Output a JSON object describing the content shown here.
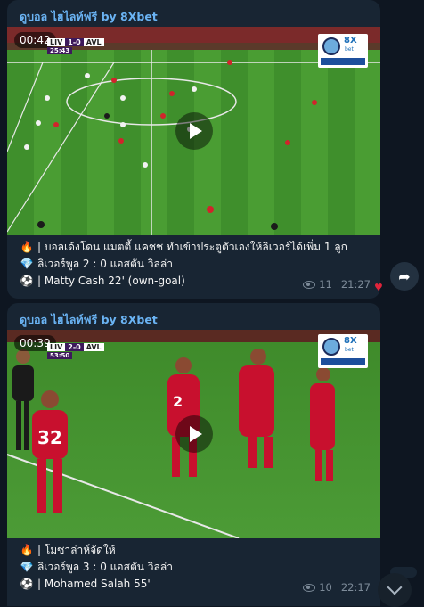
{
  "messages": [
    {
      "sender": "ดูบอล ไฮไลท์ฟรี by 8Xbet",
      "video": {
        "duration": "00:42",
        "scorebug": {
          "home": "LIV",
          "score": "1-0",
          "away": "AVL",
          "clock": "25:43"
        }
      },
      "caption": [
        {
          "icon": "fire-icon",
          "glyph": "🔥",
          "text": " | บอลเด้งโดน แมตตี้ แคชช ทำเข้าประตูตัวเองให้ลิเวอร์ได้เพิ่ม 1 ลูก"
        },
        {
          "icon": "gem-icon",
          "glyph": "💎",
          "text": " ลิเวอร์พูล 2 : 0 แอสตัน วิลล่า"
        },
        {
          "icon": "soccer-ball-icon",
          "glyph": "⚽",
          "text": " | Matty Cash  22' (own-goal)"
        }
      ],
      "views": "11",
      "time": "21:27"
    },
    {
      "sender": "ดูบอล ไฮไลท์ฟรี by 8Xbet",
      "video": {
        "duration": "00:39",
        "scorebug": {
          "home": "LIV",
          "score": "2-0",
          "away": "AVL",
          "clock": "53:50"
        }
      },
      "caption": [
        {
          "icon": "fire-icon",
          "glyph": "🔥",
          "text": " | โมซาล่าห์จัดให้"
        },
        {
          "icon": "gem-icon",
          "glyph": "💎",
          "text": " ลิเวอร์พูล 3 : 0 แอสตัน วิลล่า"
        },
        {
          "icon": "soccer-ball-icon",
          "glyph": "⚽",
          "text": " | Mohamed Salah 55'"
        }
      ],
      "views": "10",
      "time": "22:17"
    }
  ],
  "logo": {
    "brand": "8X",
    "brand_sub": "bet"
  },
  "colors": {
    "background": "#0e1621",
    "bubble": "#182533",
    "sender": "#6ab3f3",
    "meta": "#7d8b99",
    "heart": "#e0243b"
  }
}
